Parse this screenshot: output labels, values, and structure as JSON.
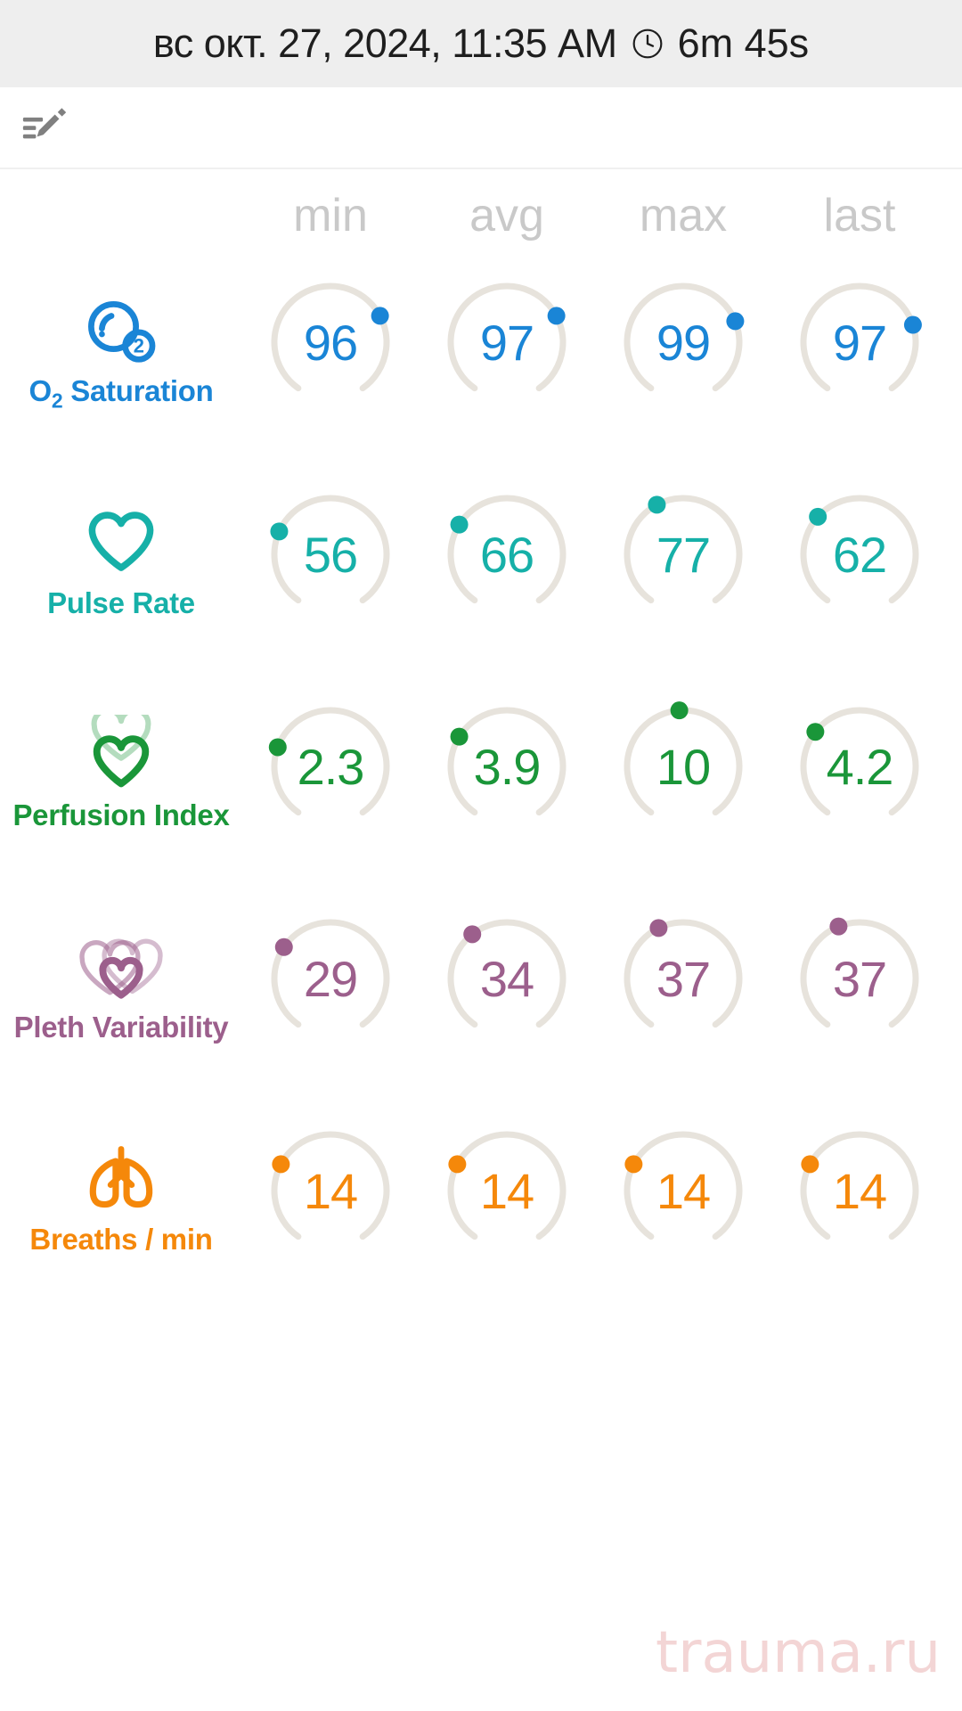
{
  "header": {
    "date_text": "вс окт. 27, 2024, 11:35 AM",
    "clock_icon": "clock-icon",
    "duration": "6m 45s",
    "background": "#eeeeee"
  },
  "toolbar": {
    "edit_icon": "edit-note-icon"
  },
  "columns": [
    "min",
    "avg",
    "max",
    "last"
  ],
  "watermark": "trauma.ru",
  "metrics": [
    {
      "name": "O",
      "name_sub": "2",
      "name_rest": " Saturation",
      "icon": "oxygen-bubble-icon",
      "color": "#1a85d6",
      "values": [
        "96",
        "97",
        "99",
        "97"
      ],
      "dot_angles": [
        62,
        62,
        68,
        72
      ]
    },
    {
      "name": "Pulse Rate",
      "icon": "heart-icon",
      "color": "#16b0a8",
      "values": [
        "56",
        "66",
        "77",
        "62"
      ],
      "dot_angles": [
        -66,
        -58,
        -28,
        -48
      ]
    },
    {
      "name": "Perfusion Index",
      "icon": "double-heart-icon",
      "color": "#1a9639",
      "values": [
        "2.3",
        "3.9",
        "10",
        "4.2"
      ],
      "dot_angles": [
        -70,
        -58,
        -4,
        -52
      ]
    },
    {
      "name": "Pleth Variability",
      "icon": "nested-hearts-icon",
      "color": "#9c5f8c",
      "values": [
        "29",
        "34",
        "37",
        "37"
      ],
      "dot_angles": [
        -56,
        -38,
        -26,
        -22
      ]
    },
    {
      "name": "Breaths / min",
      "icon": "lungs-icon",
      "color": "#f5880a",
      "values": [
        "14",
        "14",
        "14",
        "14"
      ],
      "dot_angles": [
        -62,
        -62,
        -62,
        -62
      ]
    }
  ],
  "chart_data": {
    "type": "table",
    "title": "Vital signs summary",
    "categories": [
      "min",
      "avg",
      "max",
      "last"
    ],
    "series": [
      {
        "name": "O2 Saturation",
        "values": [
          96,
          97,
          99,
          97
        ]
      },
      {
        "name": "Pulse Rate",
        "values": [
          56,
          66,
          77,
          62
        ]
      },
      {
        "name": "Perfusion Index",
        "values": [
          2.3,
          3.9,
          10,
          4.2
        ]
      },
      {
        "name": "Pleth Variability",
        "values": [
          29,
          34,
          37,
          37
        ]
      },
      {
        "name": "Breaths / min",
        "values": [
          14,
          14,
          14,
          14
        ]
      }
    ]
  }
}
